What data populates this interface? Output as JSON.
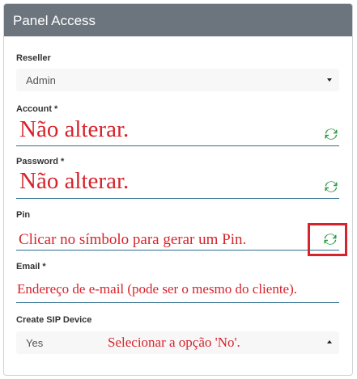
{
  "panel": {
    "title": "Panel Access"
  },
  "reseller": {
    "label": "Reseller",
    "value": "Admin"
  },
  "account": {
    "label": "Account *",
    "annotation": "Não alterar."
  },
  "password": {
    "label": "Password *",
    "annotation": "Não alterar."
  },
  "pin": {
    "label": "Pin",
    "annotation": "Clicar no símbolo para gerar um Pin."
  },
  "email": {
    "label": "Email *",
    "annotation": "Endereço de e-mail (pode ser o mesmo do cliente)."
  },
  "sip": {
    "label": "Create SIP Device",
    "value": "Yes",
    "annotation": "Selecionar a opção 'No'."
  },
  "colors": {
    "header": "#6c757d",
    "annotation": "#d7232b",
    "refresh_icon": "#2e9a43",
    "underline": "#2f6f8f"
  },
  "icons": {
    "refresh": "refresh-icon",
    "caret": "chevron-icon"
  }
}
